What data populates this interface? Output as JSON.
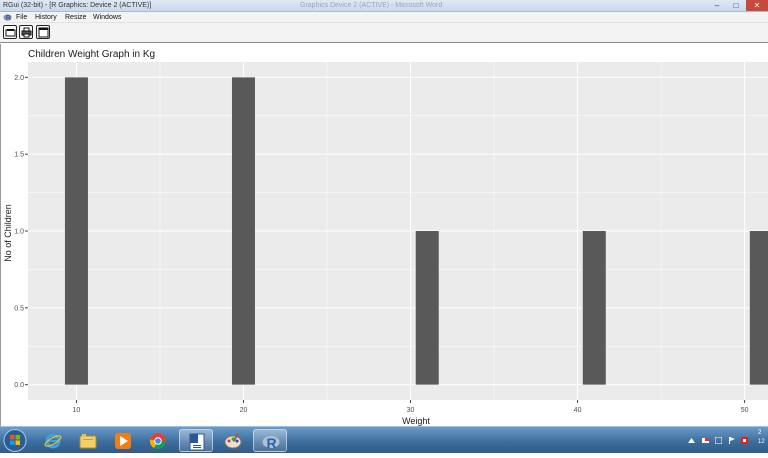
{
  "window": {
    "title": "RGui (32-bit) - [R Graphics: Device 2 (ACTIVE)]",
    "faded_title": "Graphics Device 2 (ACTIVE) - Microsoft Word",
    "minimize_glyph": "–",
    "maximize_glyph": "□",
    "close_glyph": "✕"
  },
  "menu": {
    "file": "File",
    "history": "History",
    "resize": "Resize",
    "windows": "Windows"
  },
  "toolbar": {
    "icons": [
      "copy-icon",
      "print-icon",
      "window-icon"
    ]
  },
  "chart_data": {
    "type": "bar",
    "title": "Children Weight Graph in Kg",
    "xlabel": "Weight",
    "ylabel": "No of Children",
    "x": [
      10,
      20,
      31,
      41,
      51
    ],
    "values": [
      2,
      2,
      1,
      1,
      1
    ],
    "xlim": [
      7.1,
      51.4
    ],
    "ylim": [
      -0.1,
      2.1
    ],
    "x_ticks": [
      10,
      20,
      30,
      40,
      50
    ],
    "y_ticks": [
      0.0,
      0.5,
      1.0,
      1.5,
      2.0
    ],
    "x_tick_labels": [
      "10",
      "20",
      "30",
      "40",
      "50"
    ],
    "y_tick_labels": [
      "0.0",
      "0.5",
      "1.0",
      "1.5",
      "2.0"
    ],
    "grid": true,
    "panel_background": "#ebebeb",
    "bar_color": "#595959",
    "grid_color": "#ffffff"
  },
  "taskbar": {
    "apps": [
      "start-orb",
      "ie-icon",
      "explorer-icon",
      "media-player-icon",
      "chrome-icon",
      "word-icon",
      "paint-icon",
      "r-icon"
    ],
    "r_label": "R",
    "clock_line1": "2",
    "clock_line2": "12"
  },
  "colors": {
    "accent": "#3e6e9e",
    "close": "#c9483c"
  }
}
